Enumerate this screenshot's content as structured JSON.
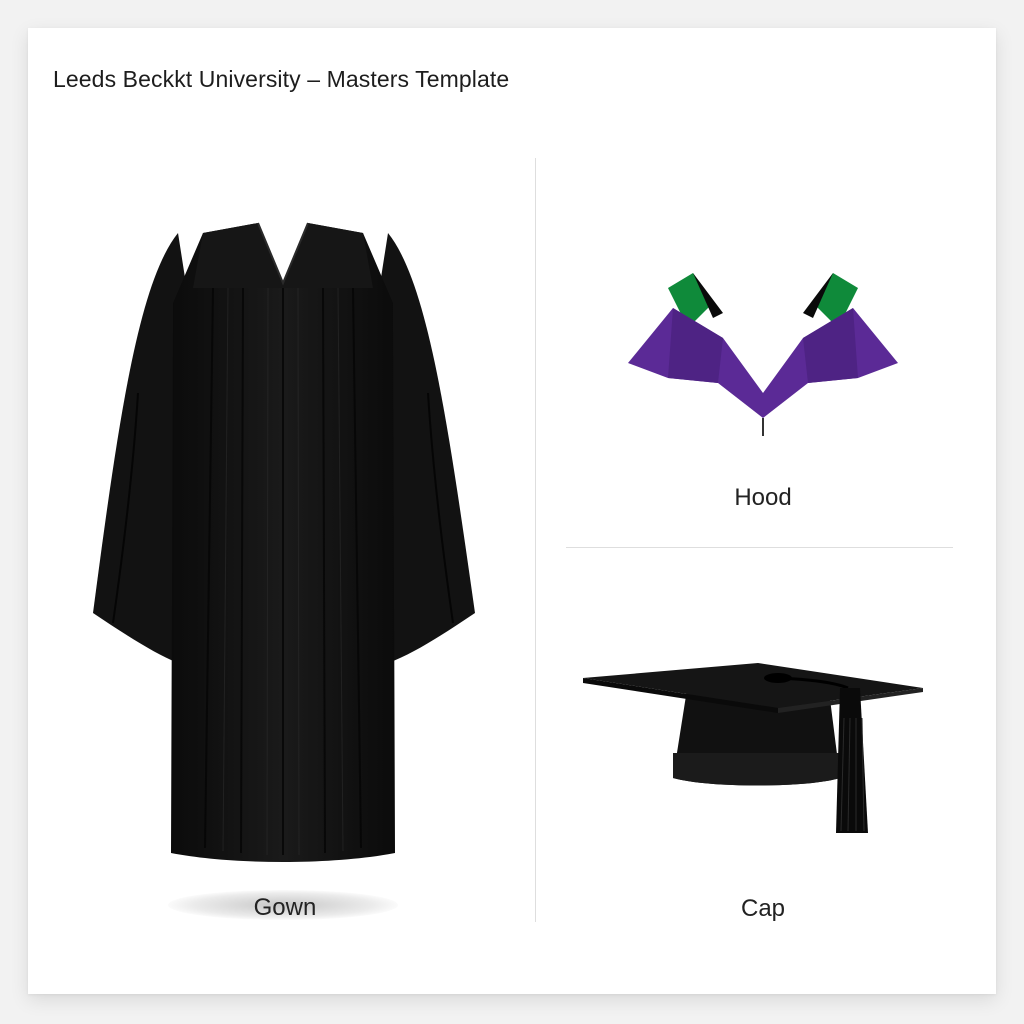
{
  "header": {
    "title": "Leeds Beckkt University – Masters Template"
  },
  "items": {
    "gown": {
      "label": "Gown",
      "color": "#111111"
    },
    "hood": {
      "label": "Hood",
      "shell_color": "#5b2a96",
      "lining_color": "#0f8a3a"
    },
    "cap": {
      "label": "Cap",
      "color": "#111111"
    }
  }
}
